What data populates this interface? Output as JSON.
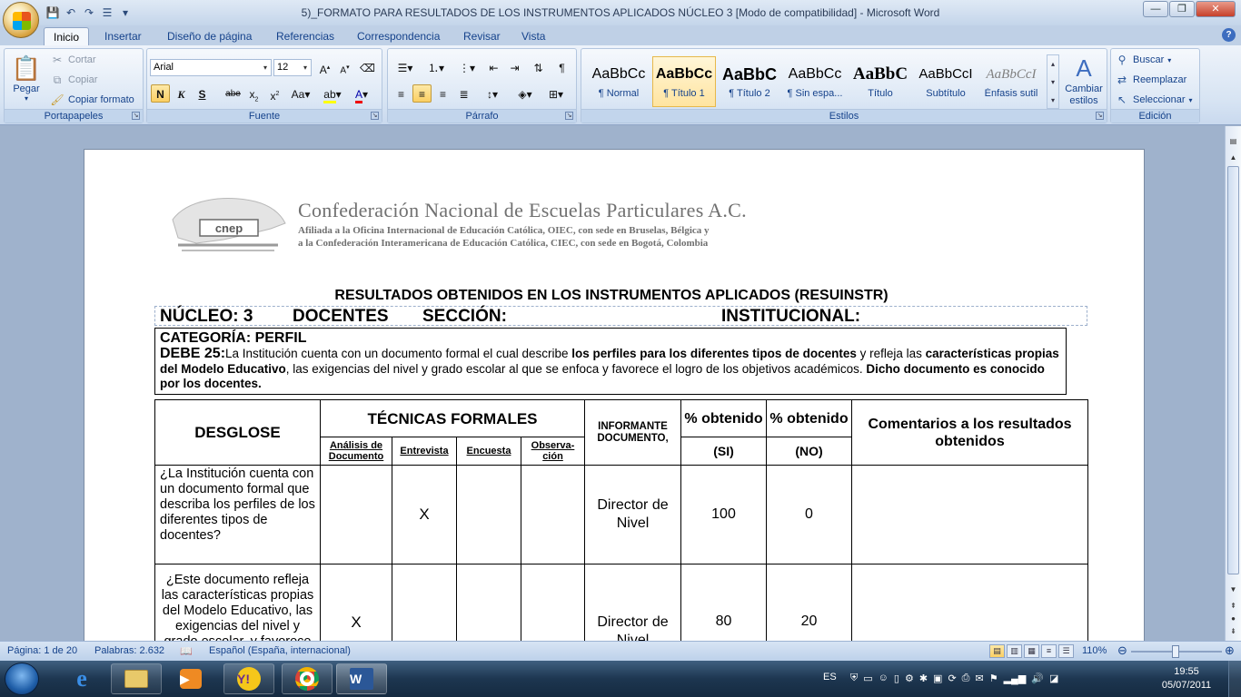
{
  "window": {
    "title": "5)_FORMATO PARA RESULTADOS DE LOS INSTRUMENTOS APLICADOS NÚCLEO 3 [Modo de compatibilidad] - Microsoft Word",
    "minimize": "—",
    "maximize": "❐",
    "close": "✕"
  },
  "tabs": [
    "Inicio",
    "Insertar",
    "Diseño de página",
    "Referencias",
    "Correspondencia",
    "Revisar",
    "Vista"
  ],
  "ribbon": {
    "clipboard": {
      "paste": "Pegar",
      "cut": "Cortar",
      "copy": "Copiar",
      "format_painter": "Copiar formato",
      "label": "Portapapeles"
    },
    "font": {
      "name": "Arial",
      "size": "12",
      "label": "Fuente"
    },
    "paragraph": {
      "label": "Párrafo"
    },
    "styles": {
      "label": "Estilos",
      "items": [
        {
          "sample": "AaBbCc",
          "name": "¶ Normal"
        },
        {
          "sample": "AaBbCc",
          "name": "¶ Título 1"
        },
        {
          "sample": "AaBbC",
          "name": "¶ Título 2"
        },
        {
          "sample": "AaBbCc",
          "name": "¶ Sin espa..."
        },
        {
          "sample": "AaBbC",
          "name": "Título"
        },
        {
          "sample": "AaBbCcI",
          "name": "Subtítulo"
        },
        {
          "sample": "AaBbCcI",
          "name": "Énfasis sutil"
        }
      ],
      "change": "Cambiar estilos"
    },
    "editing": {
      "find": "Buscar",
      "replace": "Reemplazar",
      "select": "Seleccionar",
      "label": "Edición"
    }
  },
  "document": {
    "letterhead": {
      "title": "Confederación Nacional de Escuelas Particulares A.C.",
      "line1": "Afiliada a la Oficina Internacional de Educación Católica, OIEC, con sede en Bruselas, Bélgica y",
      "line2": "a la Confederación Interamericana de Educación Católica, CIEC, con sede en Bogotá, Colombia",
      "logo_text": "cnep"
    },
    "heading": "RESULTADOS OBTENIDOS EN LOS INSTRUMENTOS APLICADOS (RESUINSTR)",
    "nucleo": {
      "a": "NÚCLEO:  3",
      "b": "DOCENTES",
      "c": "SECCIÓN:",
      "d": "INSTITUCIONAL:"
    },
    "categoria": "CATEGORÍA: PERFIL",
    "debe_label": "DEBE 25:",
    "debe_t1": "La Institución cuenta con un documento formal el cual describe ",
    "debe_b1": "los perfiles para los diferentes tipos de docentes",
    "debe_t2": " y refleja las ",
    "debe_b2": "características propias del Modelo Educativo",
    "debe_t3": ", las exigencias del nivel y grado escolar al que se enfoca y favorece el logro de los objetivos académicos. ",
    "debe_b3": "Dicho documento es conocido por los docentes.",
    "table": {
      "h_desglose": "DESGLOSE",
      "h_tecnicas": "TÉCNICAS FORMALES",
      "h_analisis": "Análisis de Documento",
      "h_entrevista": "Entrevista",
      "h_encuesta": "Encuesta",
      "h_observacion": "Observa-ción",
      "h_informante": "INFORMANTE DOCUMENTO,",
      "h_si_top": "% obtenido",
      "h_si": "(SI)",
      "h_no_top": "% obtenido",
      "h_no": "(NO)",
      "h_comentarios": "Comentarios  a los resultados obtenidos",
      "rows": [
        {
          "q": "¿La Institución cuenta con un documento formal que describa los perfiles de los diferentes tipos de docentes?",
          "analisis": "",
          "entrevista": "X",
          "encuesta": "",
          "observacion": "",
          "informante": "Director de Nivel",
          "si": "100",
          "no": "0"
        },
        {
          "q": "¿Este documento refleja las características propias del Modelo Educativo, las exigencias del nivel y grado escolar, y favorece",
          "analisis": "X",
          "entrevista": "",
          "encuesta": "",
          "observacion": "",
          "informante": "Director de Nivel",
          "si": "80",
          "no": "20"
        }
      ]
    }
  },
  "status": {
    "page": "Página: 1 de 20",
    "words": "Palabras: 2.632",
    "language": "Español (España, internacional)",
    "zoom": "110%"
  },
  "taskbar": {
    "lang": "ES",
    "time": "19:55",
    "date": "05/07/2011"
  }
}
